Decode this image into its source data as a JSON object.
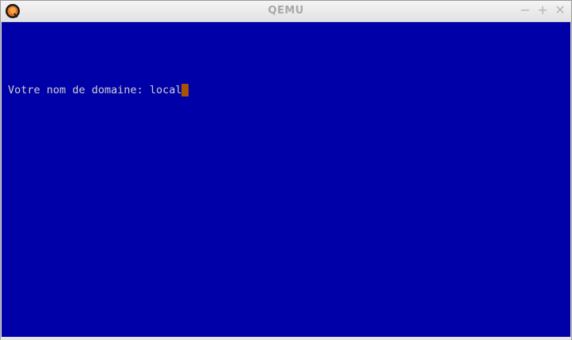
{
  "window": {
    "title": "QEMU",
    "icon": "qemu-logo-icon",
    "controls": {
      "minimize": "−",
      "maximize": "+",
      "close": "✕"
    }
  },
  "console": {
    "prompt": "Votre nom de domaine: ",
    "input_value": "local",
    "colors": {
      "background": "#0000a8",
      "text": "#cfcfcf",
      "cursor": "#a85400"
    }
  }
}
